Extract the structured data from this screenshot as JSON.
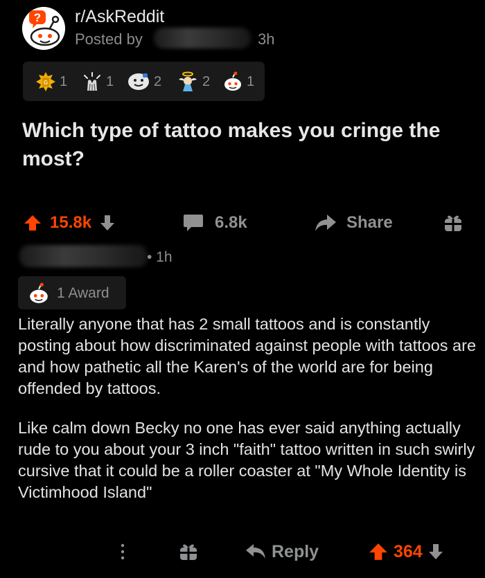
{
  "post": {
    "subreddit": "r/AskReddit",
    "posted_by_label": "Posted by",
    "time": "3h",
    "title": "Which type of tattoo makes you cringe the most?",
    "awards": [
      {
        "icon": "gold-award-icon",
        "count": "1"
      },
      {
        "icon": "wholesome-clap-award-icon",
        "count": "1"
      },
      {
        "icon": "face-award-icon",
        "count": "2"
      },
      {
        "icon": "angel-award-icon",
        "count": "2"
      },
      {
        "icon": "snoo-award-icon",
        "count": "1"
      }
    ],
    "upvotes": "15.8k",
    "comments": "6.8k",
    "share_label": "Share"
  },
  "comment": {
    "time": "• 1h",
    "award_label": "1 Award",
    "paragraphs": [
      "Literally anyone that has 2 small tattoos and is constantly posting about how discriminated against people with tattoos are and how pathetic all the Karen's of the world are for being offended by tattoos.",
      "Like calm down Becky no one has ever said anything actually rude to you about your 3 inch \"faith\" tattoo written in such swirly cursive that it could be a roller coaster at \"My Whole Identity is Victimhood Island\""
    ],
    "reply_label": "Reply",
    "score": "364"
  },
  "colors": {
    "background": "#000000",
    "upvote_accent": "#ff4500",
    "muted_text": "#8f9193",
    "chip_background": "#1a1a1b"
  }
}
